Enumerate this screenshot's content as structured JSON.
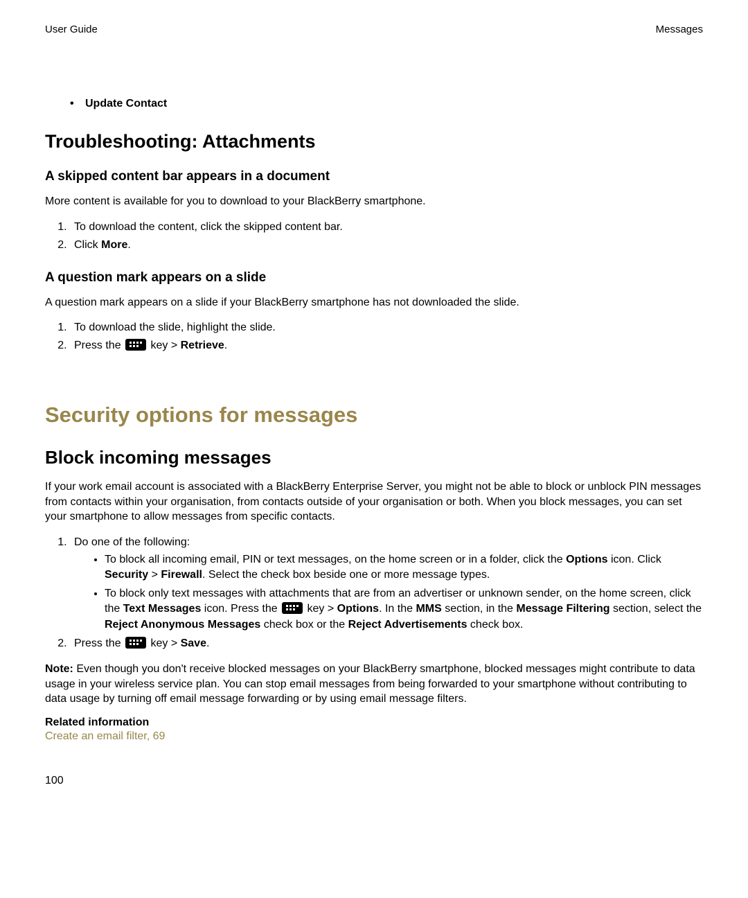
{
  "header": {
    "left": "User Guide",
    "right": "Messages"
  },
  "bullet_item": "Update Contact",
  "section1": {
    "heading": "Troubleshooting: Attachments",
    "sub1": {
      "heading": "A skipped content bar appears in a document",
      "para": "More content is available for you to download to your BlackBerry smartphone.",
      "step1": "To download the content, click the skipped content bar.",
      "step2_pre": "Click ",
      "step2_bold": "More",
      "step2_post": "."
    },
    "sub2": {
      "heading": "A question mark appears on a slide",
      "para": "A question mark appears on a slide if your BlackBerry smartphone has not downloaded the slide.",
      "step1": "To download the slide, highlight the slide.",
      "step2_pre": "Press the ",
      "step2_mid": " key > ",
      "step2_bold": "Retrieve",
      "step2_post": "."
    }
  },
  "major_heading": "Security options for messages",
  "section2": {
    "heading": "Block incoming messages",
    "para1": "If your work email account is associated with a BlackBerry Enterprise Server, you might not be able to block or unblock PIN messages from contacts within your organisation, from contacts outside of your organisation or both. When you block messages, you can set your smartphone to allow messages from specific contacts.",
    "step1_lead": "Do one of the following:",
    "step1a_t1": "To block all incoming email, PIN or text messages, on the home screen or in a folder, click the ",
    "step1a_b1": "Options",
    "step1a_t2": " icon. Click ",
    "step1a_b2": "Security",
    "step1a_t3": " > ",
    "step1a_b3": "Firewall",
    "step1a_t4": ". Select the check box beside one or more message types.",
    "step1b_t1": "To block only text messages with attachments that are from an advertiser or unknown sender, on the home screen, click the ",
    "step1b_b1": "Text Messages",
    "step1b_t2": " icon. Press the ",
    "step1b_t3": " key > ",
    "step1b_b2": "Options",
    "step1b_t4": ". In the ",
    "step1b_b3": "MMS",
    "step1b_t5": " section, in the ",
    "step1b_b4": "Message Filtering",
    "step1b_t6": " section, select the ",
    "step1b_b5": "Reject Anonymous Messages",
    "step1b_t7": " check box or the ",
    "step1b_b6": "Reject Advertisements",
    "step1b_t8": " check box.",
    "step2_pre": "Press the ",
    "step2_mid": " key > ",
    "step2_bold": "Save",
    "step2_post": ".",
    "note_label": "Note: ",
    "note_text": "Even though you don't receive blocked messages on your BlackBerry smartphone, blocked messages might contribute to data usage in your wireless service plan. You can stop email messages from being forwarded to your smartphone without contributing to data usage by turning off email message forwarding or by using email message filters.",
    "related_heading": "Related information",
    "related_link": "Create an email filter, 69"
  },
  "page_number": "100"
}
